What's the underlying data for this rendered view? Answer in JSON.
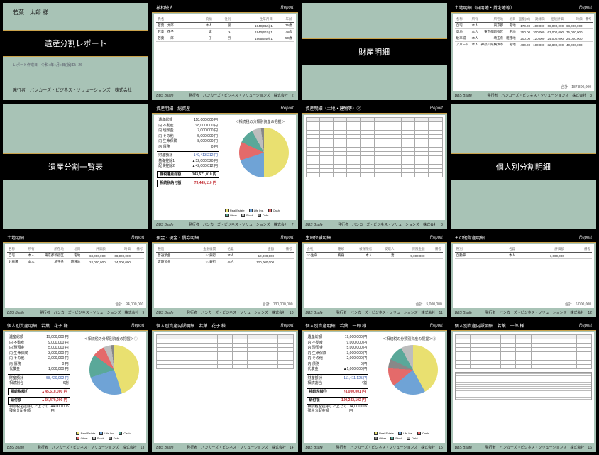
{
  "common": {
    "product": "BBS Bsafe",
    "issuer_line": "発行者　バンカーズ・ビジネス・ソリューションズ　株式会社",
    "report_logo": "Report"
  },
  "slides": [
    {
      "kind": "cover",
      "name": "若葉　太郎 様",
      "title": "遺産分割レポート",
      "subtitle": "レポート作成日　令和○年○月○日(仮)ID：26"
    },
    {
      "kind": "table",
      "header": "被相続人",
      "columns": [
        "氏名",
        "続柄",
        "性別",
        "生年月日",
        "年齢"
      ],
      "rows": [
        [
          "若葉　太郎",
          "本人",
          "男",
          "1940(S15).1",
          "75歳"
        ],
        [
          "若葉　花子",
          "妻",
          "女",
          "1940(S15).1",
          "75歳"
        ],
        [
          "若葉　一郎",
          "子",
          "男",
          "1965(S40).1",
          "50歳"
        ]
      ],
      "page": "2"
    },
    {
      "kind": "titlecard",
      "title": "財産明細"
    },
    {
      "kind": "table",
      "header": "土地明細（自用地・貸宅地等）",
      "columns": [
        "名称",
        "所有",
        "所在地",
        "地目",
        "面積(㎡)",
        "路線価",
        "相続評価",
        "時価",
        "備考"
      ],
      "rows": [
        [
          "自宅",
          "本人",
          "東京都",
          "宅地",
          "170.00",
          "400,000",
          "68,000,000",
          "68,000,000",
          ""
        ],
        [
          "貸地",
          "本人",
          "東京都新宿区",
          "宅地",
          "250.00",
          "300,000",
          "63,000,000",
          "75,000,000",
          ""
        ],
        [
          "駐車場",
          "本人",
          "埼玉県",
          "雑種地",
          "200.00",
          "120,000",
          "24,000,000",
          "24,000,000",
          ""
        ],
        [
          "アパート",
          "本人",
          "神奈川県横浜市",
          "宅地",
          "400.00",
          "100,000",
          "32,800,000",
          "40,000,000",
          ""
        ]
      ],
      "total": "187,800,000",
      "page": "3"
    },
    {
      "kind": "titlecard",
      "title": "遺産分割一覧表"
    },
    {
      "kind": "pie_summary",
      "header": "資産明細　総資産",
      "pielabel": "＜相続税の分類別資産の把握＞",
      "lines": [
        [
          "遺産総額",
          "118,000,000 円"
        ],
        [
          "内 不動産",
          "98,000,000 円"
        ],
        [
          "内 現預金",
          "7,000,000 円"
        ],
        [
          "内 その他",
          "5,000,000 円"
        ],
        [
          "内 生命保険",
          "8,000,000 円"
        ],
        [
          "内 債務",
          "0 円"
        ]
      ],
      "net_assets": {
        "label": "財産額計",
        "value": "149,413,212 円"
      },
      "deductions": [
        [
          "基礎控除1",
          "▲52,000,520 円"
        ],
        [
          "配偶控除2",
          "▲42,000,012 円"
        ]
      ],
      "taxable": {
        "label": "課税遺産総額",
        "value": "143,571,010 円"
      },
      "tax": {
        "label": "相続税納付額",
        "value": "73,449,110 円"
      },
      "legend": [
        "Real Estate",
        "Life Ins.",
        "Cash",
        "Other",
        "Stock",
        "Debt"
      ],
      "page": "7",
      "chart_data": {
        "type": "pie",
        "title": "相続税の分類別資産の把握",
        "series": [
          {
            "name": "Real Estate",
            "value": 50,
            "color": "#e9e070"
          },
          {
            "name": "Cash",
            "value": 20,
            "color": "#6fa3d6"
          },
          {
            "name": "Life Ins.",
            "value": 12,
            "color": "#e46a6a"
          },
          {
            "name": "Stock",
            "value": 10,
            "color": "#5aa899"
          },
          {
            "name": "Other",
            "value": 6,
            "color": "#bdbdbd"
          },
          {
            "name": "Debt",
            "value": 2,
            "color": "#888888"
          }
        ]
      }
    },
    {
      "kind": "densetable",
      "header": "資産明細（土地・建物等）②",
      "page": "8"
    },
    {
      "kind": "titlecard",
      "title": "個人別分割明細"
    },
    {
      "kind": "table",
      "header": "土地明細",
      "columns": [
        "名称",
        "所有",
        "所在地",
        "地目",
        "評価額",
        "時価",
        "備考"
      ],
      "rows": [
        [
          "自宅",
          "本人",
          "東京都新宿区",
          "宅地",
          "68,000,000",
          "68,000,000",
          ""
        ],
        [
          "駐車場",
          "本人",
          "埼玉県",
          "雑種地",
          "24,000,000",
          "24,000,000",
          ""
        ]
      ],
      "total": "94,000,000",
      "page": "9"
    },
    {
      "kind": "table",
      "header": "預金・現金・債券明細",
      "columns": [
        "種別",
        "金融機関",
        "名義",
        "金額",
        "備考"
      ],
      "rows": [
        [
          "普通預金",
          "○○銀行",
          "本人",
          "10,000,000",
          ""
        ],
        [
          "定期預金",
          "○○銀行",
          "本人",
          "120,000,000",
          ""
        ]
      ],
      "total": "130,000,000",
      "page": "10"
    },
    {
      "kind": "table",
      "header": "生命保険明細",
      "columns": [
        "会社",
        "種類",
        "被保険者",
        "受取人",
        "保険金額",
        "備考"
      ],
      "rows": [
        [
          "○○生命",
          "終身",
          "本人",
          "妻",
          "5,000,000",
          ""
        ]
      ],
      "total": "5,000,000",
      "page": "11"
    },
    {
      "kind": "table",
      "header": "その他財産明細",
      "columns": [
        "種別",
        "名義",
        "評価額",
        "備考"
      ],
      "rows": [
        [
          "自動車",
          "本人",
          "1,000,000",
          ""
        ]
      ],
      "total": "6,000,000",
      "page": "12"
    },
    {
      "kind": "pie_summary",
      "header": "個人別資産明細　若葉　花子 様",
      "pielabel": "＜相続税の分類別資産の把握＞①",
      "lines": [
        [
          "遺産総額",
          "19,000,000 円"
        ],
        [
          "内 不動産",
          "9,000,000 円"
        ],
        [
          "内 現預金",
          "5,000,000 円"
        ],
        [
          "内 生命保険",
          "3,000,000 円"
        ],
        [
          "内 その他",
          "2,000,000 円"
        ],
        [
          "内 債務",
          "0 円"
        ]
      ],
      "extra_row": [
        "代償金",
        "1,000,000 円"
      ],
      "net_assets": {
        "label": "財産額計",
        "value": "58,420,002 円"
      },
      "ratio": {
        "label": "相続割合",
        "value": "6割"
      },
      "boxed": [
        {
          "label": "相続税額①",
          "value": "▲45,510,000 円"
        },
        {
          "label": "納付額",
          "value": "▲56,470,000 円"
        }
      ],
      "footer_note": "相続税を控除した上での残余分配金額",
      "footer_value": "44,000,005 円",
      "legend": [
        "Real Estate",
        "Life Ins.",
        "Cash",
        "Other",
        "Stock",
        "Debt"
      ],
      "page": "13",
      "chart_data": {
        "type": "pie",
        "series": [
          {
            "name": "Real Estate",
            "value": 45,
            "color": "#e9e070"
          },
          {
            "name": "Cash",
            "value": 25,
            "color": "#6fa3d6"
          },
          {
            "name": "Life Ins.",
            "value": 15,
            "color": "#5aa899"
          },
          {
            "name": "Stock",
            "value": 8,
            "color": "#e46a6a"
          },
          {
            "name": "Other",
            "value": 5,
            "color": "#bdbdbd"
          },
          {
            "name": "Debt",
            "value": 2,
            "color": "#888888"
          }
        ]
      }
    },
    {
      "kind": "detail_person",
      "header": "個人別資産内訳明細　若葉　花子 様",
      "page": "14"
    },
    {
      "kind": "pie_summary",
      "header": "個人別資産明細　若葉　一郎 様",
      "pielabel": "＜相続税の分類別資産の把握＞②",
      "lines": [
        [
          "遺産総額",
          "19,000,000 円"
        ],
        [
          "内 不動産",
          "9,000,000 円"
        ],
        [
          "内 現預金",
          "5,000,000 円"
        ],
        [
          "内 生命保険",
          "3,000,000 円"
        ],
        [
          "内 その他",
          "2,000,000 円"
        ],
        [
          "内 債務",
          "0 円"
        ]
      ],
      "extra_row": [
        "代償金",
        "▲1,000,000 円"
      ],
      "net_assets": {
        "label": "財産額計",
        "value": "111,411,125 円"
      },
      "ratio": {
        "label": "相続割合",
        "value": "4割"
      },
      "boxed": [
        {
          "label": "相続税額①",
          "value": "78,000,001 円"
        },
        {
          "label": "納付額",
          "value": "199,242,102 円"
        }
      ],
      "footer_note": "相続税を控除した上での残余分配金額",
      "footer_value": "14,000,005 円",
      "legend": [
        "Real Estate",
        "Life Ins.",
        "Cash",
        "Other",
        "Stock",
        "Debt"
      ],
      "page": "15",
      "chart_data": {
        "type": "pie",
        "series": [
          {
            "name": "Real Estate",
            "value": 42,
            "color": "#e9e070"
          },
          {
            "name": "Cash",
            "value": 22,
            "color": "#6fa3d6"
          },
          {
            "name": "Life Ins.",
            "value": 12,
            "color": "#e46a6a"
          },
          {
            "name": "Stock",
            "value": 6,
            "color": "#888888"
          },
          {
            "name": "Other",
            "value": 10,
            "color": "#5aa899"
          },
          {
            "name": "Debt",
            "value": 8,
            "color": "#bdbdbd"
          }
        ]
      }
    },
    {
      "kind": "detail_person_hatch",
      "header": "個人別資産内訳明細　若葉　一郎 様",
      "page": "16"
    }
  ]
}
